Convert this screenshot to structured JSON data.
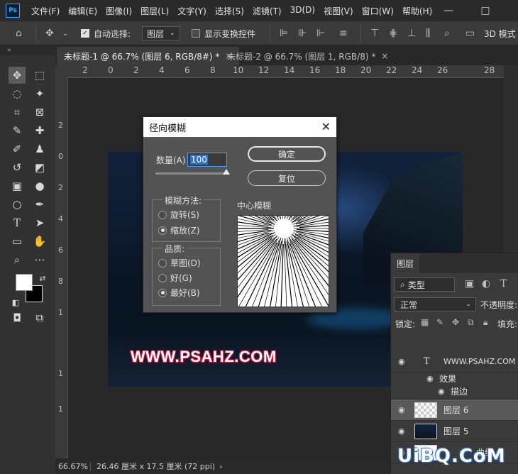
{
  "app": {
    "logo": "Ps"
  },
  "menu": [
    "文件(F)",
    "编辑(E)",
    "图像(I)",
    "图层(L)",
    "文字(Y)",
    "选择(S)",
    "滤镜(T)",
    "3D(D)",
    "视图(V)",
    "窗口(W)",
    "帮助(H)"
  ],
  "window_controls": {
    "minimize": "—",
    "maximize": "□"
  },
  "options_bar": {
    "auto_select_label": "自动选择:",
    "auto_select_target": "图层",
    "show_transform_label": "显示变换控件",
    "mode_3d": "3D 模式"
  },
  "tabs": [
    {
      "label": "未标题-1 @ 66.7% (图层 6, RGB/8#) *",
      "active": true
    },
    {
      "label": "未标题-2 @ 66.7% (图层 1, RGB/8) *",
      "active": false
    }
  ],
  "ruler": {
    "h_ticks": [
      "2",
      "0",
      "2",
      "4",
      "6",
      "8",
      "10",
      "12",
      "14",
      "16",
      "18",
      "20",
      "22",
      "24",
      "26",
      "28"
    ],
    "v_ticks": [
      "2",
      "0",
      "2",
      "4",
      "6",
      "8",
      "1",
      "1",
      "1"
    ]
  },
  "canvas": {
    "watermark": "WWW.PSAHZ.COM"
  },
  "status": {
    "zoom": "66.67%",
    "doc_info": "26.46 厘米 x 17.5 厘米 (72 ppi)"
  },
  "dialog": {
    "title": "径向模糊",
    "amount_label": "数量(A)",
    "amount_value": "100",
    "ok": "确定",
    "reset": "复位",
    "method_title": "模糊方法:",
    "methods": [
      {
        "label": "旋转(S)",
        "selected": false
      },
      {
        "label": "缩放(Z)",
        "selected": true
      }
    ],
    "quality_title": "品质:",
    "qualities": [
      {
        "label": "草图(D)",
        "selected": false
      },
      {
        "label": "好(G)",
        "selected": false
      },
      {
        "label": "最好(B)",
        "selected": true
      }
    ],
    "center_label": "中心模糊"
  },
  "layers_panel": {
    "tab": "图层",
    "filter_type": "类型",
    "blend_mode": "正常",
    "opacity_label": "不透明度:",
    "lock_label": "锁定:",
    "fill_label": "填充:",
    "layers": [
      {
        "name": "WWW.PSAHZ.COM",
        "kind": "text",
        "visible": true,
        "selected": false
      },
      {
        "name": "效果",
        "kind": "effect",
        "visible": true,
        "selected": false
      },
      {
        "name": "描边",
        "kind": "effect",
        "visible": true,
        "selected": false
      },
      {
        "name": "图层 6",
        "kind": "pixel",
        "visible": true,
        "selected": true
      },
      {
        "name": "图层 5",
        "kind": "image",
        "visible": true,
        "selected": false
      },
      {
        "name": "曲线",
        "kind": "adjustment",
        "visible": true,
        "selected": false
      }
    ]
  },
  "site_logo": "UiBQ.CoM"
}
